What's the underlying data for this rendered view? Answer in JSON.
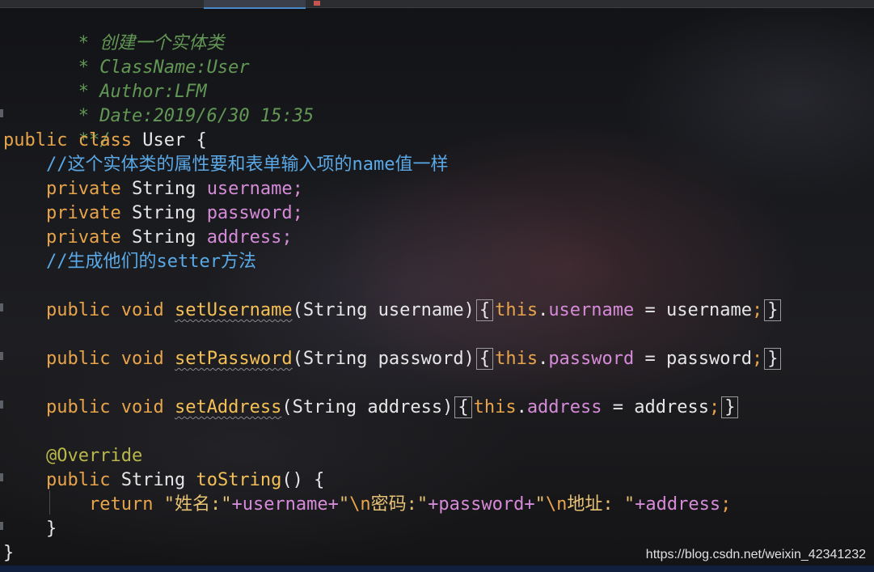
{
  "tabs": [
    {
      "name": "file-tab-1"
    },
    {
      "name": "file-tab-active"
    },
    {
      "name": "java-file-icon"
    }
  ],
  "code": {
    "doc_lines": [
      " * 创建一个实体类",
      " * ClassName:User",
      " * Author:LFM",
      " * Date:2019/6/30 15:35",
      " **/"
    ],
    "class_decl": {
      "kw1": "public",
      "kw2": "class",
      "name": "User",
      "brace": "{"
    },
    "comment_fields": "//这个实体类的属性要和表单输入项的name值一样",
    "fields": [
      {
        "mod": "private",
        "type": "String",
        "name": "username",
        "semi": ";"
      },
      {
        "mod": "private",
        "type": "String",
        "name": "password",
        "semi": ";"
      },
      {
        "mod": "private",
        "type": "String",
        "name": "address",
        "semi": ";"
      }
    ],
    "comment_setters": "//生成他们的setter方法",
    "setters": [
      {
        "mod": "public",
        "ret": "void",
        "name": "setUsername",
        "params": "(String username)",
        "open": "{",
        "this": "this",
        "field": "username",
        "assign": " = username",
        "semi": ";",
        "close": "}"
      },
      {
        "mod": "public",
        "ret": "void",
        "name": "setPassword",
        "params": "(String password)",
        "open": "{",
        "this": "this",
        "field": "password",
        "assign": " = password",
        "semi": ";",
        "close": "}"
      },
      {
        "mod": "public",
        "ret": "void",
        "name": "setAddress",
        "params": "(String address)",
        "open": "{",
        "this": "this",
        "field": "address",
        "assign": " = address",
        "semi": ";",
        "close": "}"
      }
    ],
    "annotation": "@Override",
    "tostring": {
      "mod": "public",
      "type": "String",
      "name": "toString",
      "params": "() {"
    },
    "return_line": {
      "kw": "return",
      "s1": "\"姓名:\"",
      "p1": "+username+",
      "s2a": "\"",
      "esc1": "\\n",
      "s2b": "密码:\"",
      "p2": "+password+",
      "s3a": "\"",
      "esc2": "\\n",
      "s3b": "地址: \"",
      "p3": "+",
      "v3": "address",
      "semi": ";"
    },
    "method_close": "}",
    "class_close": "}"
  },
  "watermark": "https://blog.csdn.net/weixin_42341232",
  "colors": {
    "keyword": "#e8a44a",
    "field": "#d58bd8",
    "method": "#f5c055",
    "comment": "#5aa8e6",
    "doc": "#629755",
    "string": "#e8c274",
    "annotation": "#b9b74a"
  }
}
